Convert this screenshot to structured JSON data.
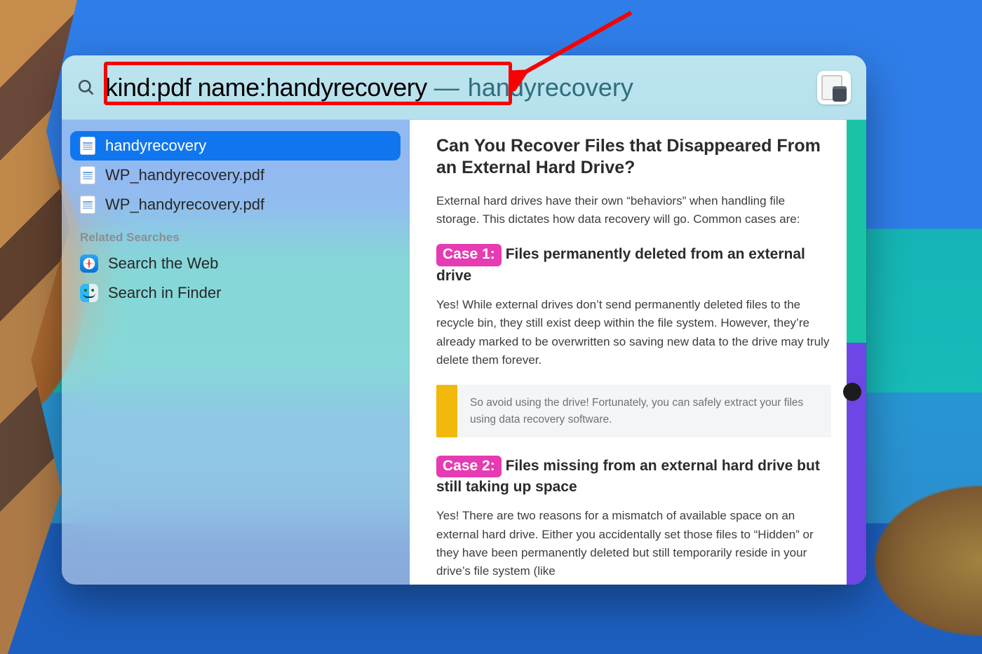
{
  "search": {
    "query": "kind:pdf name:handyrecovery",
    "autocomplete": "handyrecovery"
  },
  "results": [
    {
      "name": "handyrecovery",
      "selected": true
    },
    {
      "name": "WP_handyrecovery.pdf",
      "selected": false
    },
    {
      "name": "WP_handyrecovery.pdf",
      "selected": false
    }
  ],
  "related_section_title": "Related Searches",
  "related": [
    {
      "label": "Search the Web",
      "icon": "safari"
    },
    {
      "label": "Search in Finder",
      "icon": "finder"
    }
  ],
  "preview": {
    "heading": "Can You Recover Files that Disappeared From an External Hard Drive?",
    "intro": "External hard drives have their own “behaviors” when handling file storage. This dictates how data recovery will go. Common cases are:",
    "case1_badge": "Case 1:",
    "case1_title": "Files permanently deleted from an external drive",
    "case1_body": "Yes! While external drives don’t send permanently deleted files to the recycle bin, they still exist deep within the file system. However, they’re already marked to be overwritten so saving new data to the drive may truly delete them forever.",
    "tip": "So avoid using the drive! Fortunately, you can safely extract your files using data recovery software.",
    "case2_badge": "Case 2:",
    "case2_title": "Files missing from an external hard drive but still taking up space",
    "case2_body": "Yes! There are two reasons for a mismatch of available space on an external hard drive. Either you accidentally set those files to “Hidden” or they have been permanently deleted but still temporarily reside in your drive’s file system (like"
  }
}
